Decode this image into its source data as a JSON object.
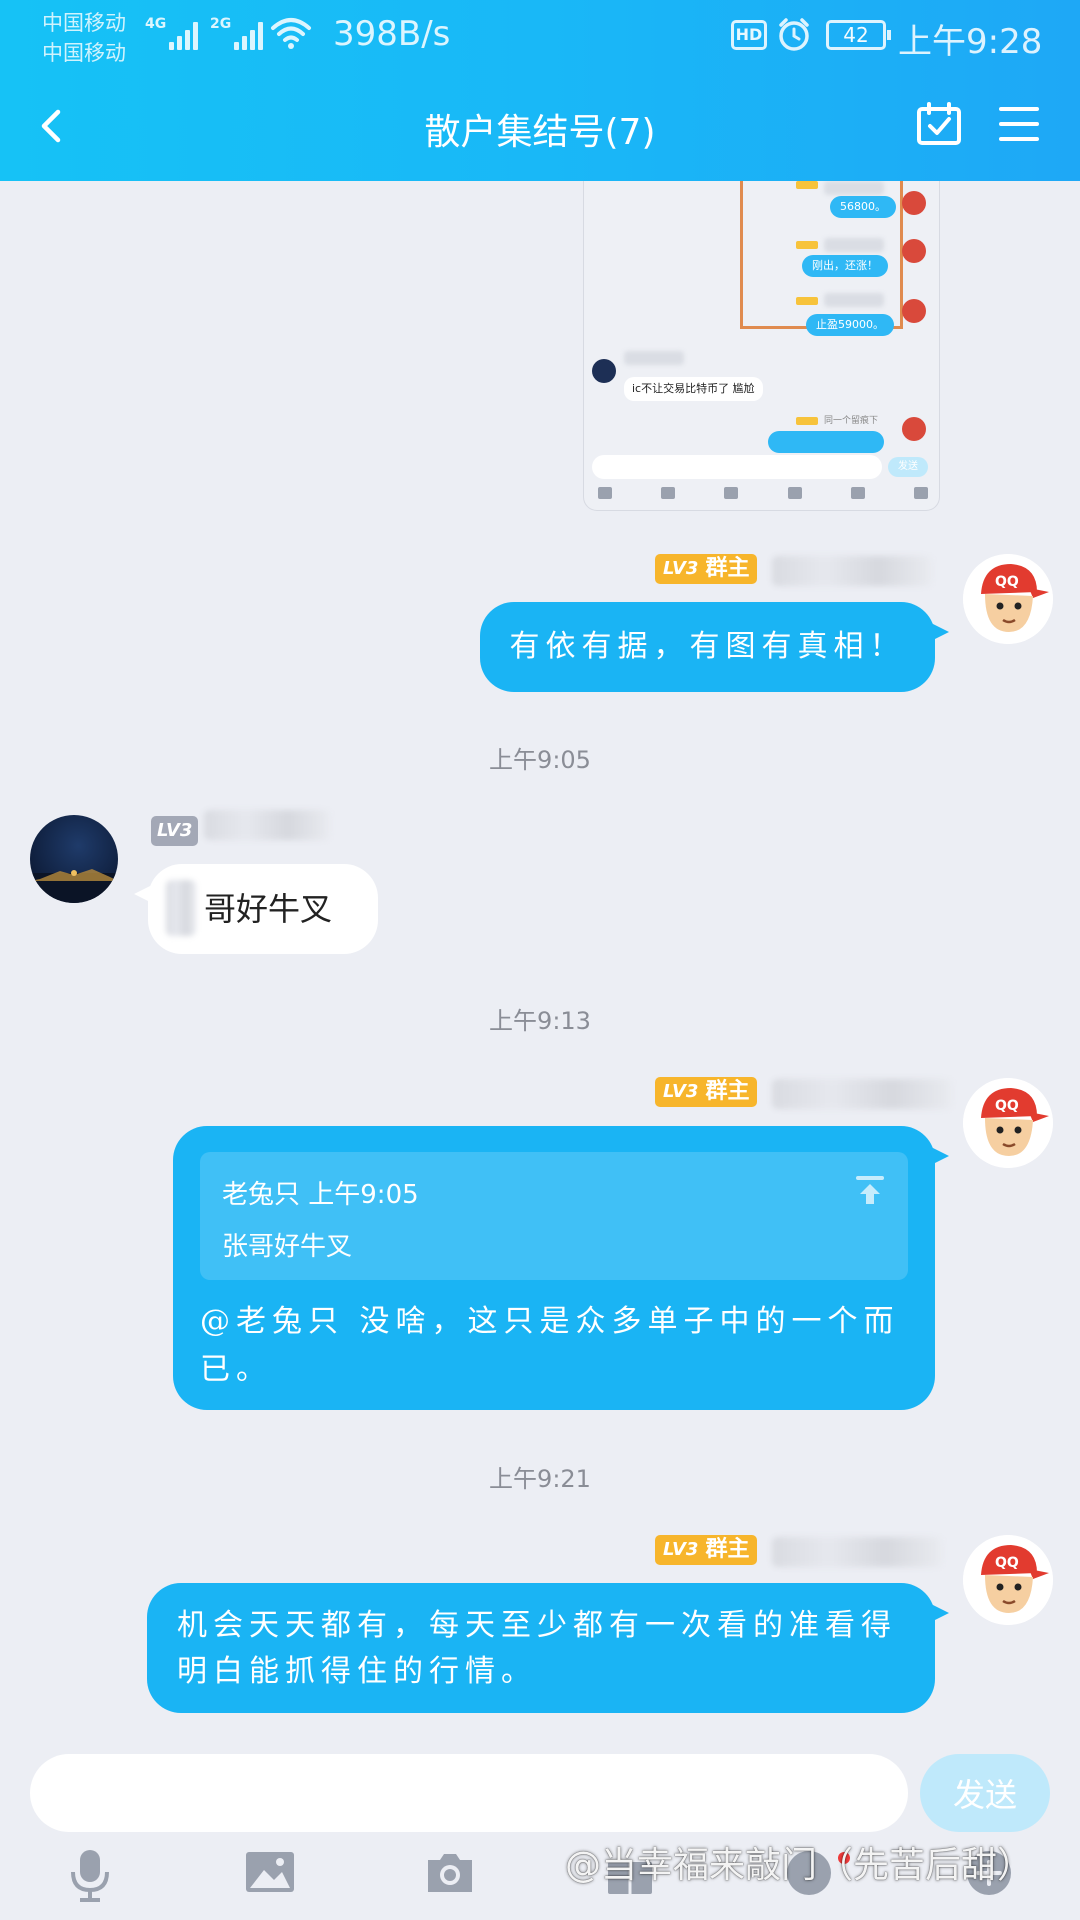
{
  "status_bar": {
    "carrier_1": "中国移动",
    "carrier_2": "中国移动",
    "net_1": "4G",
    "net_2": "2G",
    "net_speed": "398B/s",
    "hd": "HD",
    "battery": "42",
    "time": "上午9:28"
  },
  "header": {
    "title": "散户集结号(7)",
    "icons": [
      "back-arrow-icon",
      "calendar-check-icon",
      "menu-icon"
    ]
  },
  "shared_screenshot": {
    "bubbles": [
      "56800。",
      "刚出，还涨！",
      "止盈59000。"
    ],
    "other_message": "ic不让交易比特币了 尴尬",
    "bottom_tag": "同一个留痕下",
    "send_label": "发送"
  },
  "messages": [
    {
      "id": "m1",
      "badge_lv": "LV3",
      "badge_role": "群主",
      "text": "有依有据，有图有真相！"
    },
    {
      "id": "t1",
      "timestamp": "上午9:05"
    },
    {
      "id": "m2",
      "badge_lv": "LV3",
      "text": "哥好牛叉"
    },
    {
      "id": "t2",
      "timestamp": "上午9:13"
    },
    {
      "id": "m3",
      "badge_lv": "LV3",
      "badge_role": "群主",
      "quote_header": "老兔只 上午9:05",
      "quote_text": "张哥好牛叉",
      "text_line1": "@老兔只 没啥，这只是众多单子中的一个而",
      "text_line2": "已。"
    },
    {
      "id": "t3",
      "timestamp": "上午9:21"
    },
    {
      "id": "m4",
      "badge_lv": "LV3",
      "badge_role": "群主",
      "text_line1": "机会天天都有，每天至少都有一次看的准看得",
      "text_line2": "明白能抓得住的行情。"
    }
  ],
  "input_bar": {
    "placeholder": "",
    "send_label": "发送",
    "toolbar_icons": [
      "mic-icon",
      "image-icon",
      "camera-icon",
      "gift-icon",
      "emoji-icon",
      "plus-icon"
    ]
  },
  "watermark": "@当幸福来敲门（先苦后甜）",
  "colors": {
    "header": "#19b8f7",
    "bubble_me": "#1ab4f4",
    "owner_badge": "#f7b52b",
    "background": "#eceef4"
  }
}
